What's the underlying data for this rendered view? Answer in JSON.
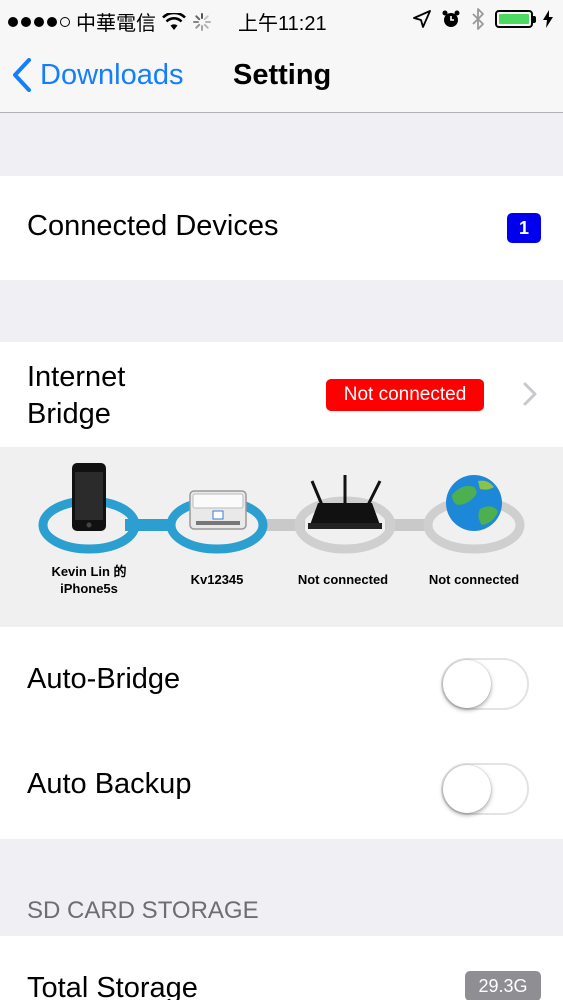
{
  "status_bar": {
    "carrier": "中華電信",
    "time": "上午11:21"
  },
  "nav": {
    "back_label": "Downloads",
    "title": "Setting"
  },
  "connected_devices": {
    "label": "Connected Devices",
    "count": "1"
  },
  "internet_bridge": {
    "label_line1": "Internet",
    "label_line2": "Bridge",
    "status": "Not connected"
  },
  "diagram": {
    "phone_line1": "Kevin Lin 的",
    "phone_line2": "iPhone5s",
    "device": "Kv12345",
    "router": "Not connected",
    "internet": "Not connected"
  },
  "auto_bridge": {
    "label": "Auto-Bridge",
    "on": false
  },
  "auto_backup": {
    "label": "Auto Backup",
    "on": false
  },
  "sd_card": {
    "header": "SD CARD STORAGE",
    "total_label": "Total Storage",
    "total_value": "29.3G"
  },
  "colors": {
    "accent": "#147efb",
    "badge_blue": "#0000ee",
    "badge_red": "#ff0000",
    "link_blue": "#2a9fd0",
    "link_gray": "#c9c9c9"
  }
}
